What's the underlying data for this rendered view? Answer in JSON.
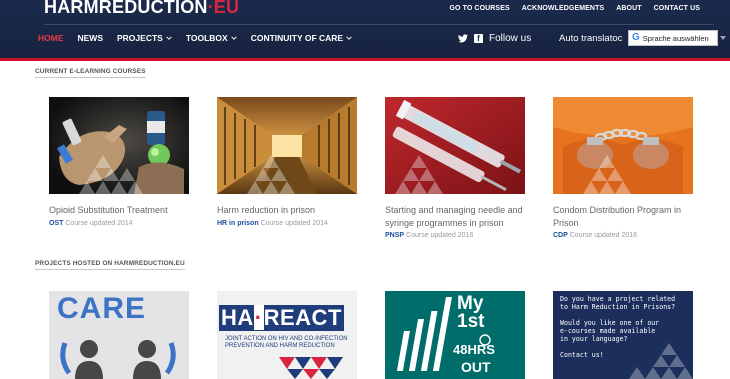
{
  "header": {
    "logo": {
      "part1": "HARM",
      "part2": "REDUCTION",
      "part3": "·EU"
    },
    "top_links": [
      "GO TO COURSES",
      "ACKNOWLEDGEMENTS",
      "ABOUT",
      "CONTACT US"
    ],
    "nav": [
      {
        "label": "HOME",
        "active": true
      },
      {
        "label": "NEWS"
      },
      {
        "label": "PROJECTS",
        "dropdown": true
      },
      {
        "label": "TOOLBOX",
        "dropdown": true
      },
      {
        "label": "CONTINUITY OF CARE",
        "dropdown": true
      }
    ],
    "follow_label": "Follow us",
    "auto_translate": "Auto translatoc",
    "language_select": "Sprache auswählen",
    "colors": {
      "bg": "#1b2a4c",
      "accent": "#c8102e",
      "active_nav": "#e8394c"
    }
  },
  "courses_section": {
    "title": "CURRENT E-LEARNING COURSES",
    "courses": [
      {
        "title": "Opioid Substitution Treatment",
        "code": "OST",
        "updated": "Course updated 2014"
      },
      {
        "title": "Harm reduction in prison",
        "code": "HR in prison",
        "updated": "Course updated 2014"
      },
      {
        "title": "Starting and managing needle and syringe programmes in prison",
        "code": "PNSP",
        "updated": "Course updated 2016"
      },
      {
        "title": "Condom Distribution Program in Prison",
        "code": "CDP",
        "updated": "Course updated 2016"
      }
    ]
  },
  "projects_section": {
    "title": "PROJECTS HOSTED ON HARMREDUCTION.EU",
    "projects": [
      {
        "text": "CARE"
      },
      {
        "logo_a": "HA",
        "logo_dot": "·",
        "logo_b": "REACT",
        "subtitle": "JOINT ACTION ON HIV AND CO-INFECTION PREVENTION AND HARM REDUCTION"
      },
      {
        "line1": "My",
        "line2": "1st",
        "line3": "48HRS",
        "line4": "OUT"
      },
      {
        "text": "Do you have a project related\nto Harm Reduction in Prisons?\n\nWould you like one of our\ne-courses made available\nin your language?\n\nContact us!"
      }
    ]
  }
}
